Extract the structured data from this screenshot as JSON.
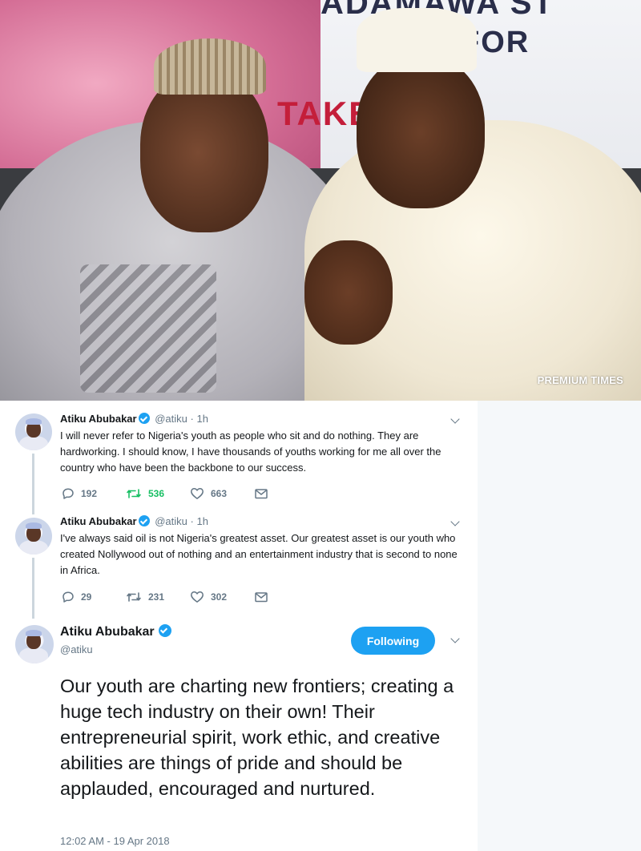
{
  "photo": {
    "banner_line1": "ADAMAWA ST",
    "banner_line2": "FOR",
    "banner_line3": "TAKE",
    "watermark": "PREMIUM TIMES"
  },
  "colors": {
    "verified": "#1da1f2",
    "retweet_active": "#17bf63",
    "muted": "#657786",
    "follow_button": "#1da1f2"
  },
  "thread": [
    {
      "name": "Atiku Abubakar",
      "handle": "@atiku",
      "dot": "·",
      "time": "1h",
      "text": "I will never refer to Nigeria's youth as people who sit and do nothing. They are hardworking. I should know, I have thousands of youths working for me all over the country who have been the backbone to our success.",
      "replies": "192",
      "retweets": "536",
      "likes": "663",
      "retweet_active": true
    },
    {
      "name": "Atiku Abubakar",
      "handle": "@atiku",
      "dot": "·",
      "time": "1h",
      "text": "I've always said oil is not Nigeria's greatest asset. Our greatest asset is our youth who created Nollywood out of nothing and an entertainment industry that is second to none in Africa.",
      "replies": "29",
      "retweets": "231",
      "likes": "302",
      "retweet_active": false
    }
  ],
  "main_tweet": {
    "name": "Atiku Abubakar",
    "handle": "@atiku",
    "follow_label": "Following",
    "text": "Our youth are charting new frontiers; creating a huge tech industry on their own! Their entrepreneurial spirit, work ethic, and creative abilities are things of pride and should be applauded, encouraged and nurtured.",
    "timestamp": "12:02 AM - 19 Apr 2018"
  }
}
